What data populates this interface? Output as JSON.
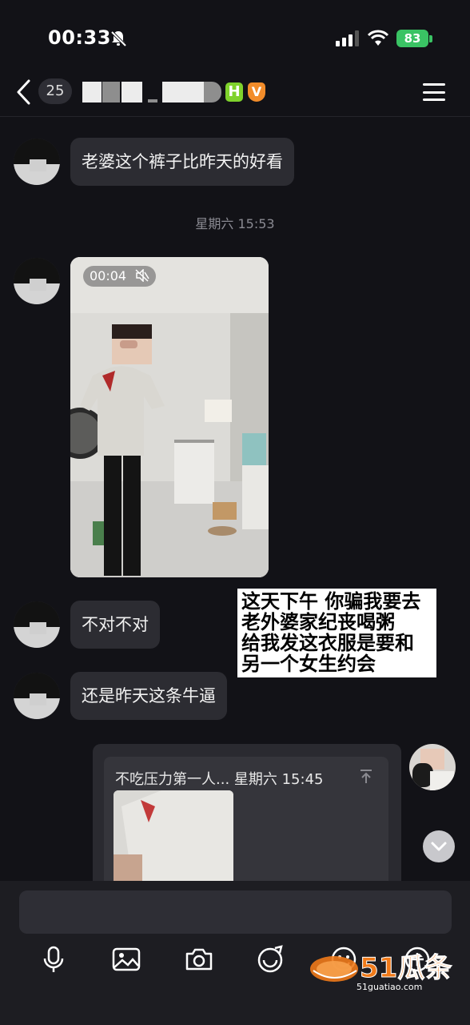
{
  "status_bar": {
    "time": "00:33",
    "battery": "83"
  },
  "header": {
    "unread_count": "25",
    "badge_h": "H",
    "badge_v": "V"
  },
  "messages": [
    {
      "text": "老婆这个裤子比昨天的好看"
    },
    {
      "text": "不对不对"
    },
    {
      "text": "还是昨天这条牛逼"
    }
  ],
  "timestamp": "星期六 15:53",
  "video": {
    "duration": "00:04"
  },
  "overlay_caption": [
    "这天下午 你骗我要去",
    "老外婆家纪丧喝粥",
    "给我发这衣服是要和",
    "另一个女生约会"
  ],
  "shared_card": {
    "title": "不吃压力第一人... 星期六 15:45"
  },
  "input": {
    "placeholder": ""
  },
  "watermark": {
    "brand": "51瓜条",
    "site": "51guatiao.com"
  },
  "colors": {
    "background": "#121217",
    "bubble": "#2c2c32",
    "battery": "#3ac364"
  }
}
